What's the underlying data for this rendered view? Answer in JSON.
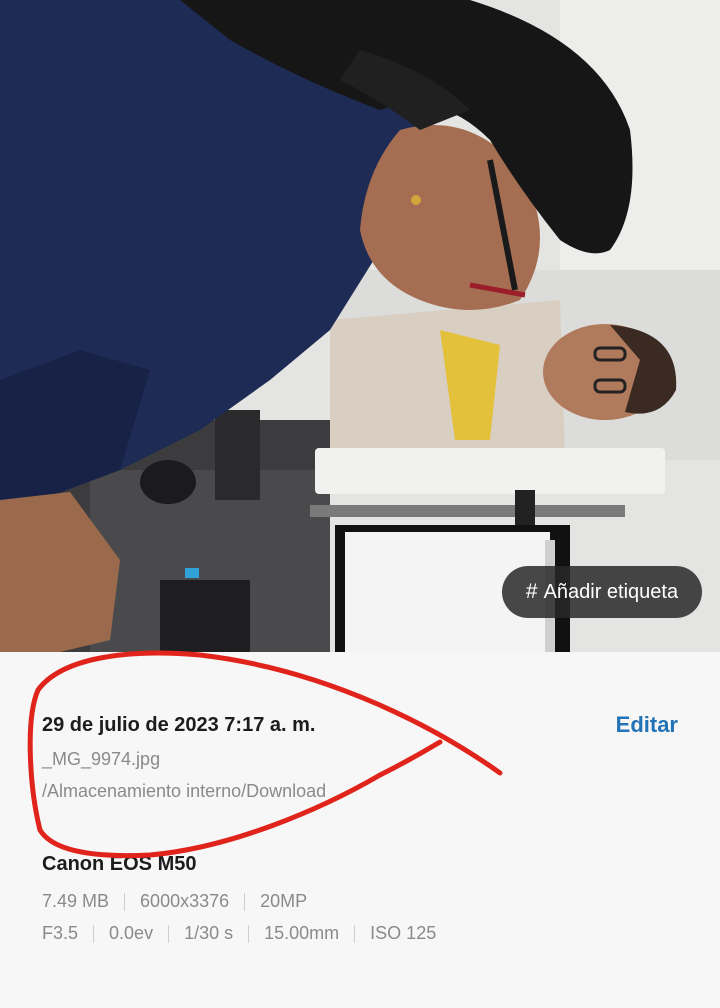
{
  "photo": {
    "tag_button_label": "Añadir etiqueta",
    "tag_button_icon": "hash-icon"
  },
  "details": {
    "date": "29 de julio de 2023 7:17 a. m.",
    "edit_label": "Editar",
    "filename": "_MG_9974.jpg",
    "path": "/Almacenamiento interno/Download",
    "camera": "Canon EOS M50",
    "row1": [
      "7.49 MB",
      "6000x3376",
      "20MP"
    ],
    "row2": [
      "F3.5",
      "0.0ev",
      "1/30 s",
      "15.00mm",
      "ISO 125"
    ]
  },
  "colors": {
    "accent": "#2373b8",
    "annotation": "#e0241c"
  }
}
